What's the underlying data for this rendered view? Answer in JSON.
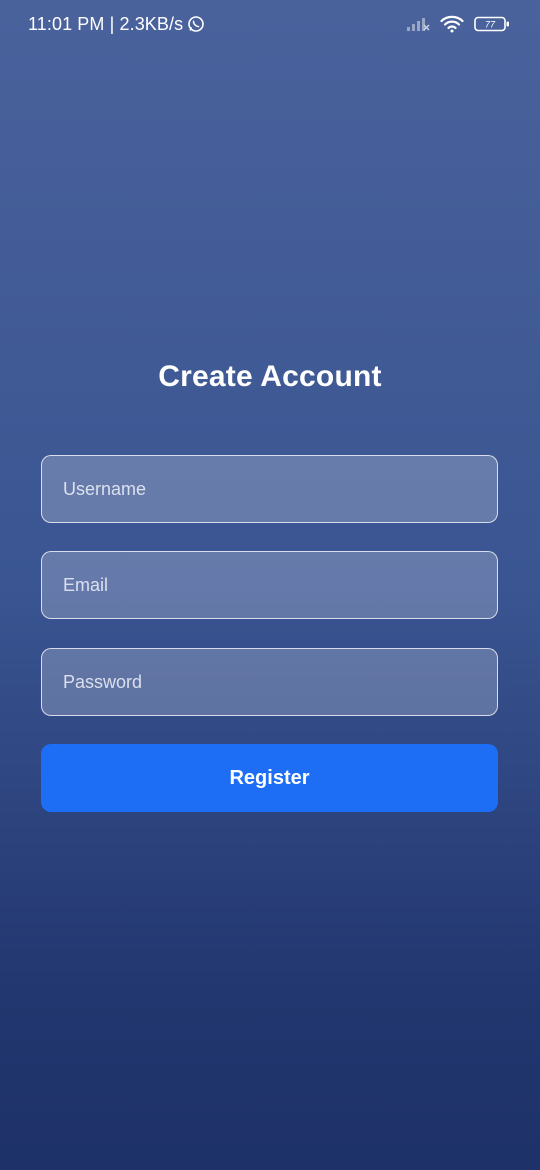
{
  "status_bar": {
    "time_speed": "11:01 PM | 2.3KB/s",
    "battery_level": "77",
    "icons": [
      "whatsapp-icon",
      "signal-icon",
      "wifi-icon",
      "battery-icon"
    ]
  },
  "screen": {
    "title": "Create Account"
  },
  "form": {
    "username_placeholder": "Username",
    "email_placeholder": "Email",
    "password_placeholder": "Password",
    "register_label": "Register"
  },
  "colors": {
    "background_top": "#4a629c",
    "background_bottom": "#1e3269",
    "button": "#1e6ef5",
    "text": "#ffffff"
  }
}
